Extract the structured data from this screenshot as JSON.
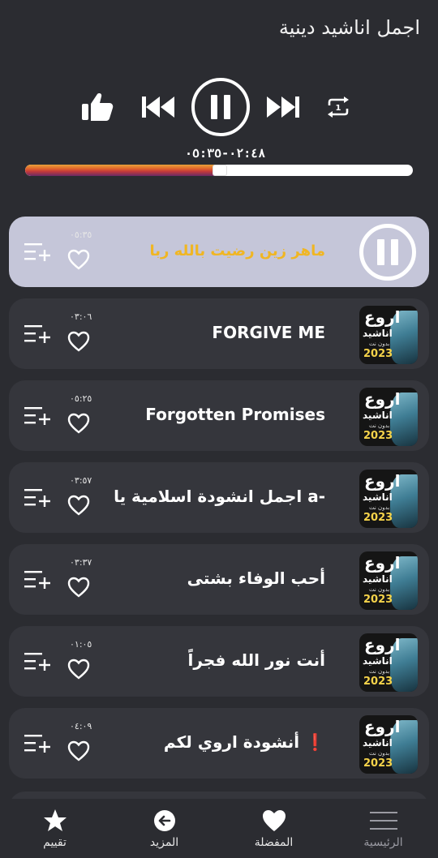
{
  "header": {
    "title": "اجمل اناشيد دينية"
  },
  "player": {
    "elapsed": "٠٢:٤٨",
    "total": "٠٥:٣٥",
    "time_display": "٠٢:٤٨-٠٥:٣٥",
    "progress_fraction": 0.5,
    "accent_gradient": [
      "#e8a23a",
      "#e2672a",
      "#c43a3a",
      "#6a2b66"
    ]
  },
  "controls": {
    "like_icon": "thumbs-up-icon",
    "prev_icon": "skip-previous-icon",
    "pause_icon": "pause-circle-icon",
    "next_icon": "skip-next-icon",
    "repeat_icon": "repeat-one-icon",
    "repeat_badge": "1"
  },
  "tracks": [
    {
      "title": "ماهر زين رضيت بالله ربا",
      "duration": "٠٥:٣٥",
      "active": true
    },
    {
      "title": "FORGIVE ME",
      "duration": "٠٣:٠٦",
      "active": false
    },
    {
      "title": "Forgotten Promises",
      "duration": "٠٥:٢٥",
      "active": false
    },
    {
      "title": "اجمل انشودة اسلامية يا a-",
      "duration": "٠٣:٥٧",
      "active": false
    },
    {
      "title": "أحب الوفاء بشتى",
      "duration": "٠٣:٣٧",
      "active": false
    },
    {
      "title": "أنت نور الله فجراً",
      "duration": "٠١:٠٥",
      "active": false
    },
    {
      "title": "أنشودة اروي لكم ❗",
      "duration": "٠٤:٠٩",
      "active": false
    }
  ],
  "thumbnail": {
    "line1": "اروع",
    "line2": "اناشيد",
    "line3": "بدون نت",
    "line4": "2023"
  },
  "nav": {
    "home": "الرئيسية",
    "favorites": "المفضلة",
    "more": "المزيد",
    "rate": "تقييم"
  },
  "colors": {
    "background": "#2b2c31",
    "row": "#35363c",
    "active_row": "#c5c6d9",
    "active_title": "#f0b623"
  }
}
